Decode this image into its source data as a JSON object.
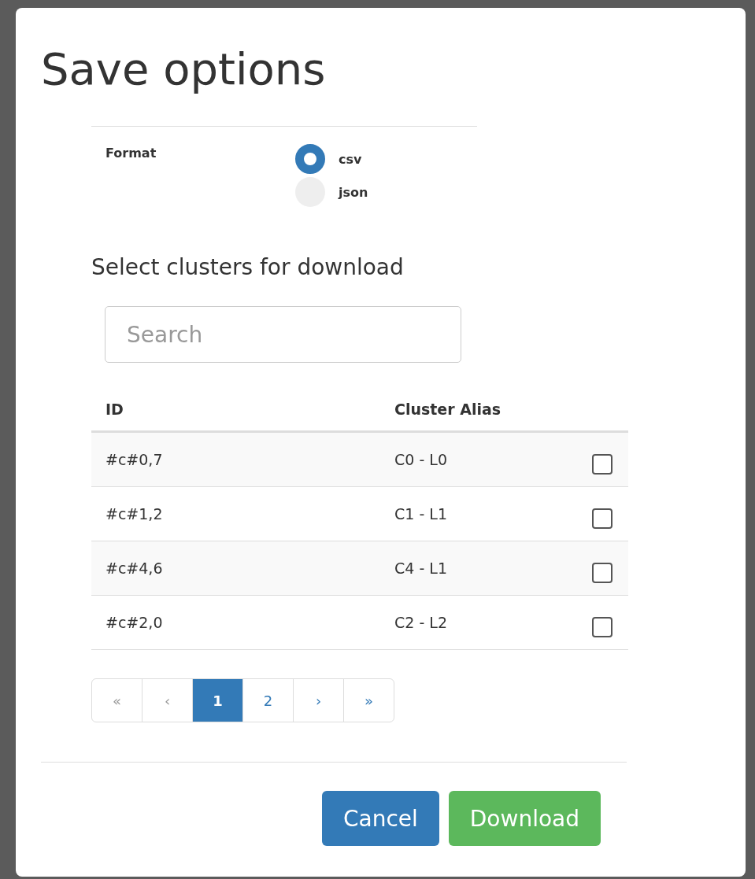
{
  "dialog": {
    "title": "Save options"
  },
  "format": {
    "label": "Format",
    "options": [
      {
        "label": "csv",
        "selected": true
      },
      {
        "label": "json",
        "selected": false
      }
    ]
  },
  "clusters": {
    "heading": "Select clusters for download",
    "search": {
      "placeholder": "Search"
    },
    "columns": [
      "ID",
      "Cluster Alias"
    ],
    "rows": [
      {
        "id": "#c#0,7",
        "alias": "C0 - L0",
        "checked": false
      },
      {
        "id": "#c#1,2",
        "alias": "C1 - L1",
        "checked": false
      },
      {
        "id": "#c#4,6",
        "alias": "C4 - L1",
        "checked": false
      },
      {
        "id": "#c#2,0",
        "alias": "C2 - L2",
        "checked": false
      }
    ]
  },
  "pagination": [
    {
      "label": "«",
      "selected": false,
      "disabled": true
    },
    {
      "label": "‹",
      "selected": false,
      "disabled": true
    },
    {
      "label": "1",
      "selected": true,
      "disabled": false
    },
    {
      "label": "2",
      "selected": false,
      "disabled": false
    },
    {
      "label": "›",
      "selected": false,
      "disabled": false
    },
    {
      "label": "»",
      "selected": false,
      "disabled": false
    }
  ],
  "buttons": [
    {
      "label": "Cancel",
      "kind": "primary"
    },
    {
      "label": "Download",
      "kind": "success"
    }
  ]
}
